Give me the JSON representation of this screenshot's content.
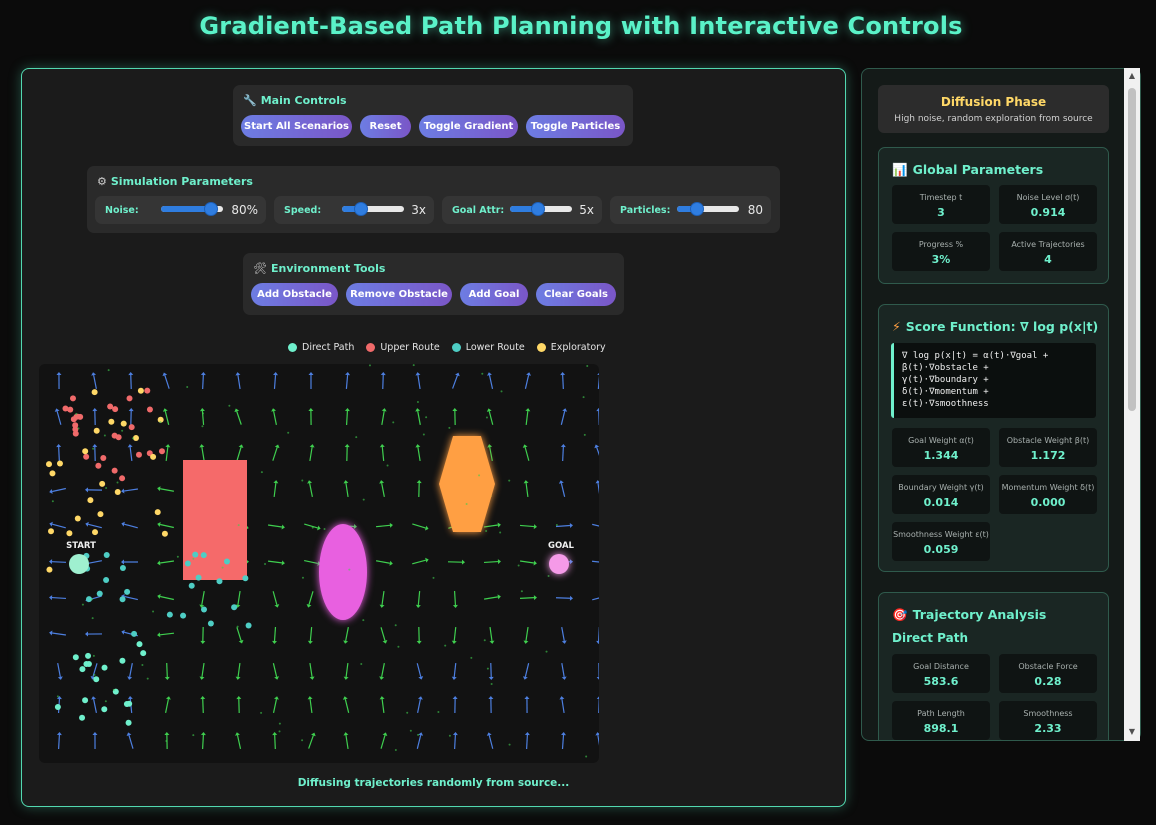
{
  "title": "Gradient-Based Path Planning with Interactive Controls",
  "main_controls": {
    "icon": "wrench-icon",
    "title": "Main Controls",
    "buttons": [
      "Start All Scenarios",
      "Reset",
      "Toggle Gradient",
      "Toggle Particles"
    ]
  },
  "sim_params": {
    "icon": "gear-icon",
    "title": "Simulation Parameters",
    "params": [
      {
        "label": "Noise:",
        "value": "80%",
        "level": 0.8
      },
      {
        "label": "Speed:",
        "value": "3x",
        "level": 0.3
      },
      {
        "label": "Goal Attr:",
        "value": "5x",
        "level": 0.45
      },
      {
        "label": "Particles:",
        "value": "80",
        "level": 0.32
      }
    ],
    "slider_color": "#2f7de0"
  },
  "env_tools": {
    "icon": "tools-icon",
    "title": "Environment Tools",
    "buttons": [
      "Add Obstacle",
      "Remove Obstacle",
      "Add Goal",
      "Clear Goals"
    ]
  },
  "legend": [
    {
      "label": "Direct Path",
      "color": "#6ff0cc"
    },
    {
      "label": "Upper Route",
      "color": "#f06a6a"
    },
    {
      "label": "Lower Route",
      "color": "#4ecdc4"
    },
    {
      "label": "Exploratory",
      "color": "#ffd867"
    }
  ],
  "canvas": {
    "start_label": "START",
    "goal_label": "GOAL",
    "colors": {
      "start": "#9ff0d0",
      "goal": "#f59ae8",
      "rect_obstacle": "#f56a6a",
      "ellipse_obstacle": "#e860e0",
      "hex_obstacle": "#ff9f43",
      "arrow_green": "#3fcf4f",
      "arrow_blue": "#4d7fe0"
    }
  },
  "status_text": "Diffusing trajectories randomly from source...",
  "phase": {
    "title": "Diffusion Phase",
    "description": "High noise, random exploration from source"
  },
  "global_params": {
    "icon": "chart-icon",
    "title": "Global Parameters",
    "stats": [
      {
        "label": "Timestep t",
        "value": "3"
      },
      {
        "label": "Noise Level σ(t)",
        "value": "0.914"
      },
      {
        "label": "Progress %",
        "value": "3%"
      },
      {
        "label": "Active Trajectories",
        "value": "4"
      }
    ]
  },
  "score_function": {
    "icon": "lightning-icon",
    "title": "Score Function: ∇ log p(x|t)",
    "formula": "∇ log p(x|t) = α(t)·∇goal +\nβ(t)·∇obstacle +\nγ(t)·∇boundary +\nδ(t)·∇momentum +\nε(t)·∇smoothness",
    "weights": [
      {
        "label": "Goal Weight α(t)",
        "value": "1.344"
      },
      {
        "label": "Obstacle Weight β(t)",
        "value": "1.172"
      },
      {
        "label": "Boundary Weight γ(t)",
        "value": "0.014"
      },
      {
        "label": "Momentum Weight δ(t)",
        "value": "0.000"
      },
      {
        "label": "Smoothness Weight ε(t)",
        "value": "0.059"
      }
    ]
  },
  "trajectory_analysis": {
    "icon": "target-icon",
    "title": "Trajectory Analysis",
    "subtitle": "Direct Path",
    "stats": [
      {
        "label": "Goal Distance",
        "value": "583.6"
      },
      {
        "label": "Obstacle Force",
        "value": "0.28"
      },
      {
        "label": "Path Length",
        "value": "898.1"
      },
      {
        "label": "Smoothness",
        "value": "2.33"
      }
    ]
  }
}
